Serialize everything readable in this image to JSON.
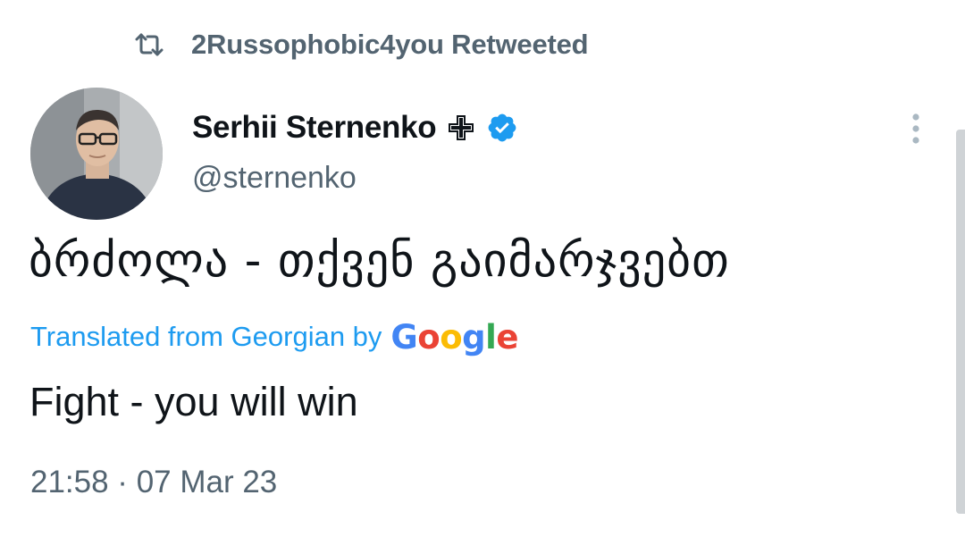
{
  "retweet": {
    "label": "2Russophobic4you Retweeted",
    "icon": "retweet-icon"
  },
  "author": {
    "display_name": "Serhii Sternenko",
    "handle": "@sternenko",
    "badge_icon": "cross-icon",
    "verified_icon": "verified-badge-icon",
    "verified_color": "#1d9bf0"
  },
  "menu": {
    "icon": "more-vertical-icon"
  },
  "tweet": {
    "text": "ბრძოლა - თქვენ გაიმარჯვებთ",
    "translation_label": "Translated from Georgian by",
    "translation_provider": [
      "G",
      "o",
      "o",
      "g",
      "l",
      "e"
    ],
    "translated_text": "Fight - you will win",
    "timestamp": "21:58 · 07 Mar 23"
  },
  "colors": {
    "link": "#1d9bf0",
    "secondary_text": "#536471",
    "primary_text": "#0f1419"
  }
}
